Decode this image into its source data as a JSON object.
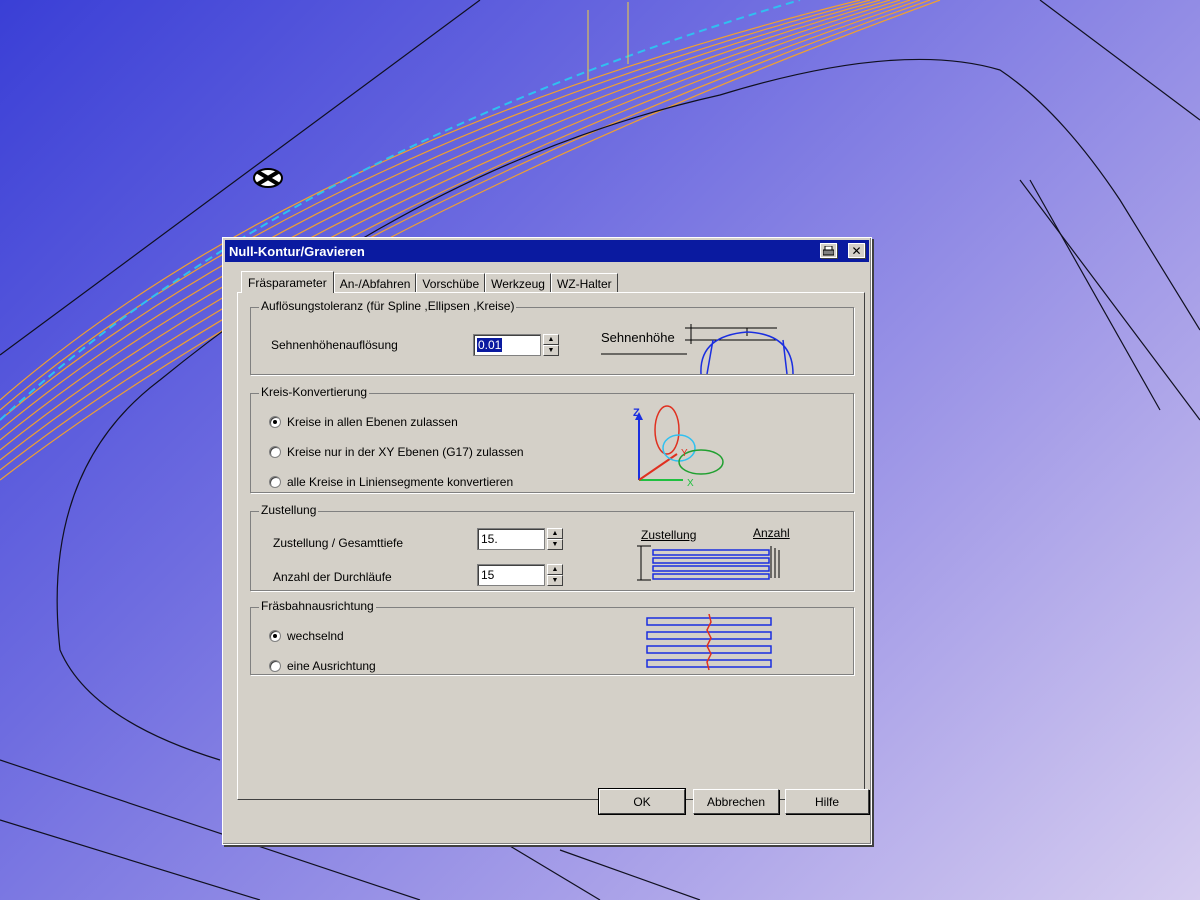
{
  "dialog": {
    "title": "Null-Kontur/Gravieren",
    "title_icons": [
      "printer-icon",
      "close-icon"
    ]
  },
  "tabs": [
    {
      "label": "Fräsparameter",
      "active": true
    },
    {
      "label": "An-/Abfahren",
      "active": false
    },
    {
      "label": "Vorschübe",
      "active": false
    },
    {
      "label": "Werkzeug",
      "active": false
    },
    {
      "label": "WZ-Halter",
      "active": false
    }
  ],
  "aufloesung": {
    "group_title": "Auflösungstoleranz (für Spline ,Ellipsen ,Kreise)",
    "field_label": "Sehnenhöhenauflösung",
    "value": "0.01",
    "diagram_label": "Sehnenhöhe"
  },
  "kreis": {
    "group_title": "Kreis-Konvertierung",
    "options": [
      {
        "label": "Kreise in allen Ebenen zulassen",
        "selected": true
      },
      {
        "label": "Kreise nur in der XY Ebenen (G17)  zulassen",
        "selected": false
      },
      {
        "label": "alle Kreise in Liniensegmente konvertieren",
        "selected": false
      }
    ],
    "axis_labels": {
      "z": "Z",
      "y": "Y",
      "x": "X"
    }
  },
  "zustellung": {
    "group_title": "Zustellung",
    "fields": [
      {
        "label": "Zustellung / Gesamttiefe",
        "value": "15."
      },
      {
        "label": "Anzahl der Durchläufe",
        "value": "15"
      }
    ],
    "diagram_labels": {
      "left": "Zustellung",
      "right": "Anzahl"
    }
  },
  "fraesbahn": {
    "group_title": "Fräsbahnausrichtung",
    "options": [
      {
        "label": "wechselnd",
        "selected": true
      },
      {
        "label": "eine Ausrichtung",
        "selected": false
      }
    ]
  },
  "buttons": {
    "ok": "OK",
    "cancel": "Abbrechen",
    "help": "Hilfe"
  },
  "colors": {
    "titlebar": "#0a1aa0",
    "dialog_face": "#d4d0c8",
    "diagram_blue": "#1a2ee0",
    "toolpath_orange": "#f0a030"
  }
}
